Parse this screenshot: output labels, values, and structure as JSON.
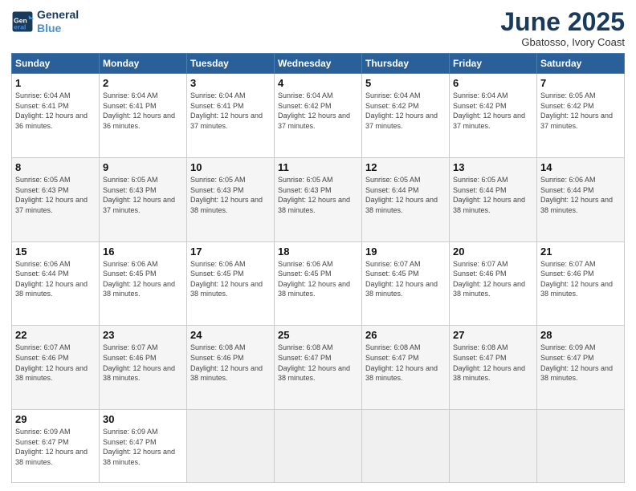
{
  "logo": {
    "line1": "General",
    "line2": "Blue"
  },
  "title": "June 2025",
  "subtitle": "Gbatosso, Ivory Coast",
  "days_header": [
    "Sunday",
    "Monday",
    "Tuesday",
    "Wednesday",
    "Thursday",
    "Friday",
    "Saturday"
  ],
  "weeks": [
    [
      {
        "num": "1",
        "rise": "6:04 AM",
        "set": "6:41 PM",
        "daylight": "12 hours and 36 minutes."
      },
      {
        "num": "2",
        "rise": "6:04 AM",
        "set": "6:41 PM",
        "daylight": "12 hours and 36 minutes."
      },
      {
        "num": "3",
        "rise": "6:04 AM",
        "set": "6:41 PM",
        "daylight": "12 hours and 37 minutes."
      },
      {
        "num": "4",
        "rise": "6:04 AM",
        "set": "6:42 PM",
        "daylight": "12 hours and 37 minutes."
      },
      {
        "num": "5",
        "rise": "6:04 AM",
        "set": "6:42 PM",
        "daylight": "12 hours and 37 minutes."
      },
      {
        "num": "6",
        "rise": "6:04 AM",
        "set": "6:42 PM",
        "daylight": "12 hours and 37 minutes."
      },
      {
        "num": "7",
        "rise": "6:05 AM",
        "set": "6:42 PM",
        "daylight": "12 hours and 37 minutes."
      }
    ],
    [
      {
        "num": "8",
        "rise": "6:05 AM",
        "set": "6:43 PM",
        "daylight": "12 hours and 37 minutes."
      },
      {
        "num": "9",
        "rise": "6:05 AM",
        "set": "6:43 PM",
        "daylight": "12 hours and 37 minutes."
      },
      {
        "num": "10",
        "rise": "6:05 AM",
        "set": "6:43 PM",
        "daylight": "12 hours and 38 minutes."
      },
      {
        "num": "11",
        "rise": "6:05 AM",
        "set": "6:43 PM",
        "daylight": "12 hours and 38 minutes."
      },
      {
        "num": "12",
        "rise": "6:05 AM",
        "set": "6:44 PM",
        "daylight": "12 hours and 38 minutes."
      },
      {
        "num": "13",
        "rise": "6:05 AM",
        "set": "6:44 PM",
        "daylight": "12 hours and 38 minutes."
      },
      {
        "num": "14",
        "rise": "6:06 AM",
        "set": "6:44 PM",
        "daylight": "12 hours and 38 minutes."
      }
    ],
    [
      {
        "num": "15",
        "rise": "6:06 AM",
        "set": "6:44 PM",
        "daylight": "12 hours and 38 minutes."
      },
      {
        "num": "16",
        "rise": "6:06 AM",
        "set": "6:45 PM",
        "daylight": "12 hours and 38 minutes."
      },
      {
        "num": "17",
        "rise": "6:06 AM",
        "set": "6:45 PM",
        "daylight": "12 hours and 38 minutes."
      },
      {
        "num": "18",
        "rise": "6:06 AM",
        "set": "6:45 PM",
        "daylight": "12 hours and 38 minutes."
      },
      {
        "num": "19",
        "rise": "6:07 AM",
        "set": "6:45 PM",
        "daylight": "12 hours and 38 minutes."
      },
      {
        "num": "20",
        "rise": "6:07 AM",
        "set": "6:46 PM",
        "daylight": "12 hours and 38 minutes."
      },
      {
        "num": "21",
        "rise": "6:07 AM",
        "set": "6:46 PM",
        "daylight": "12 hours and 38 minutes."
      }
    ],
    [
      {
        "num": "22",
        "rise": "6:07 AM",
        "set": "6:46 PM",
        "daylight": "12 hours and 38 minutes."
      },
      {
        "num": "23",
        "rise": "6:07 AM",
        "set": "6:46 PM",
        "daylight": "12 hours and 38 minutes."
      },
      {
        "num": "24",
        "rise": "6:08 AM",
        "set": "6:46 PM",
        "daylight": "12 hours and 38 minutes."
      },
      {
        "num": "25",
        "rise": "6:08 AM",
        "set": "6:47 PM",
        "daylight": "12 hours and 38 minutes."
      },
      {
        "num": "26",
        "rise": "6:08 AM",
        "set": "6:47 PM",
        "daylight": "12 hours and 38 minutes."
      },
      {
        "num": "27",
        "rise": "6:08 AM",
        "set": "6:47 PM",
        "daylight": "12 hours and 38 minutes."
      },
      {
        "num": "28",
        "rise": "6:09 AM",
        "set": "6:47 PM",
        "daylight": "12 hours and 38 minutes."
      }
    ],
    [
      {
        "num": "29",
        "rise": "6:09 AM",
        "set": "6:47 PM",
        "daylight": "12 hours and 38 minutes."
      },
      {
        "num": "30",
        "rise": "6:09 AM",
        "set": "6:47 PM",
        "daylight": "12 hours and 38 minutes."
      },
      null,
      null,
      null,
      null,
      null
    ]
  ]
}
